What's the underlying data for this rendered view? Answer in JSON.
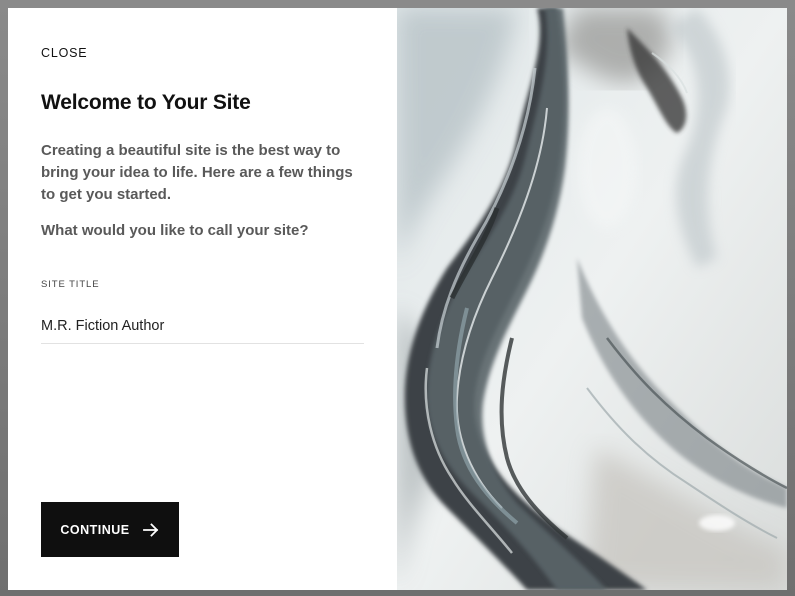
{
  "dialog": {
    "close_label": "CLOSE",
    "title": "Welcome to Your Site",
    "description": "Creating a beautiful site is the best way to bring your idea to life. Here are a few things to get you started.",
    "question": "What would you like to call your site?",
    "site_title_label": "SITE TITLE",
    "site_title_value": "M.R. Fiction Author",
    "continue_label": "CONTINUE"
  },
  "colors": {
    "button_bg": "#0f0f0f",
    "text_primary": "#111111",
    "text_secondary": "#595959",
    "backdrop": "#7d7d7d"
  },
  "icons": {
    "continue_arrow": "arrow-right-icon",
    "hero": "marble-image"
  }
}
